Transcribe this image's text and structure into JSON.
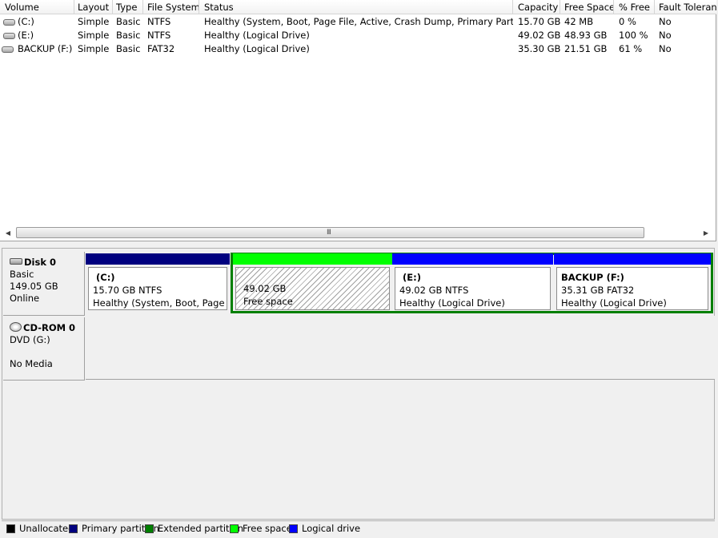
{
  "volume_list": {
    "columns": [
      "Volume",
      "Layout",
      "Type",
      "File System",
      "Status",
      "Capacity",
      "Free Space",
      "% Free",
      "Fault Toleran"
    ],
    "rows": [
      {
        "volume": "(C:)",
        "layout": "Simple",
        "type": "Basic",
        "fs": "NTFS",
        "status": "Healthy (System, Boot, Page File, Active, Crash Dump, Primary Partition)",
        "capacity": "15.70 GB",
        "free": "42 MB",
        "pct": "0 %",
        "fault": "No"
      },
      {
        "volume": "(E:)",
        "layout": "Simple",
        "type": "Basic",
        "fs": "NTFS",
        "status": "Healthy (Logical Drive)",
        "capacity": "49.02 GB",
        "free": "48.93 GB",
        "pct": "100 %",
        "fault": "No"
      },
      {
        "volume": "BACKUP (F:)",
        "layout": "Simple",
        "type": "Basic",
        "fs": "FAT32",
        "status": "Healthy (Logical Drive)",
        "capacity": "35.30 GB",
        "free": "21.51 GB",
        "pct": "61 %",
        "fault": "No"
      }
    ],
    "scroll_grip": "III",
    "scroll_left": "◀",
    "scroll_right": "▶"
  },
  "disk0": {
    "name": "Disk 0",
    "type": "Basic",
    "size": "149.05 GB",
    "status": "Online",
    "partitions": {
      "c": {
        "name": "(C:)",
        "size_fs": "15.70 GB NTFS",
        "status": "Healthy (System, Boot, Page Fil"
      },
      "free": {
        "size": "49.02 GB",
        "label": "Free space"
      },
      "e": {
        "name": "(E:)",
        "size_fs": "49.02 GB NTFS",
        "status": "Healthy (Logical Drive)"
      },
      "f": {
        "name": "BACKUP  (F:)",
        "size_fs": "35.31 GB FAT32",
        "status": "Healthy (Logical Drive)"
      }
    }
  },
  "cdrom0": {
    "name": "CD-ROM 0",
    "drive": "DVD (G:)",
    "media": "No Media"
  },
  "legend": {
    "unallocated": "Unallocated",
    "primary": "Primary partition",
    "extended": "Extended partition",
    "free": "Free space",
    "logical": "Logical drive"
  },
  "colors": {
    "unallocated": "#000000",
    "primary": "#00007f",
    "extended": "#007f00",
    "free": "#00ff00",
    "logical": "#0000ff"
  }
}
